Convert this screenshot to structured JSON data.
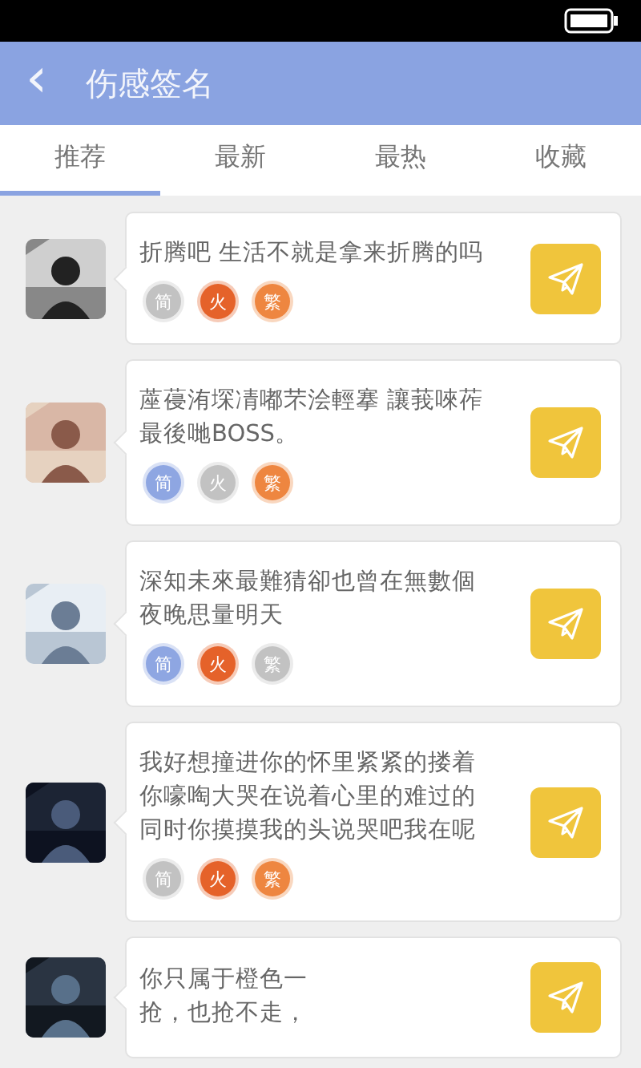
{
  "header": {
    "back_icon": "‹",
    "title": "伤感签名"
  },
  "tabs": [
    {
      "label": "推荐",
      "selected": true
    },
    {
      "label": "最新",
      "selected": false
    },
    {
      "label": "最热",
      "selected": false
    },
    {
      "label": "收藏",
      "selected": false
    }
  ],
  "posts": [
    {
      "lines": [
        "折腾吧 生活不就是拿来折腾的吗"
      ],
      "badges": [
        {
          "label": "简",
          "color": "#c2c2c2"
        },
        {
          "label": "火",
          "color": "#e5622a"
        },
        {
          "label": "繁",
          "color": "#ee8640"
        }
      ]
    },
    {
      "lines": [
        "蓙葠洧堔凊嘟芣浍輕搴 讓莪唻莋",
        "最後哋BOSS。"
      ],
      "badges": [
        {
          "label": "简",
          "color": "#8ea6e2"
        },
        {
          "label": "火",
          "color": "#c2c2c2"
        },
        {
          "label": "繁",
          "color": "#ee8640"
        }
      ]
    },
    {
      "lines": [
        "深知未來最難猜卻也曾在無數個",
        "夜晚思量明天"
      ],
      "badges": [
        {
          "label": "简",
          "color": "#8ea6e2"
        },
        {
          "label": "火",
          "color": "#e5622a"
        },
        {
          "label": "繁",
          "color": "#c2c2c2"
        }
      ]
    },
    {
      "lines": [
        "我好想撞进你的怀里紧紧的搂着",
        "你嚎啕大哭在说着心里的难过的",
        "同时你摸摸我的头说哭吧我在呢"
      ],
      "badges": [
        {
          "label": "简",
          "color": "#c2c2c2"
        },
        {
          "label": "火",
          "color": "#e5622a"
        },
        {
          "label": "繁",
          "color": "#ee8640"
        }
      ]
    },
    {
      "lines": [
        "你只属于橙色一",
        "抢，也抢不走，"
      ]
    }
  ]
}
